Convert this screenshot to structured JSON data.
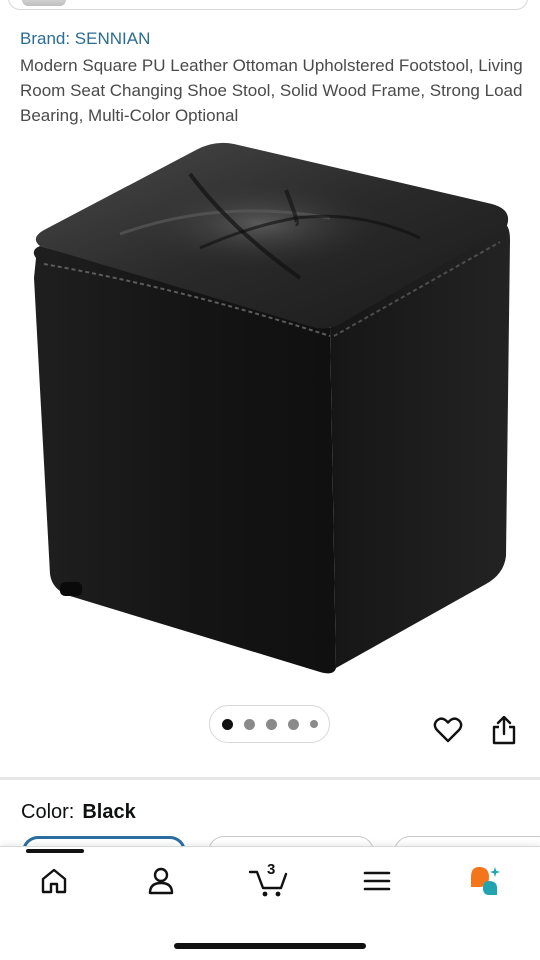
{
  "product": {
    "brand_label": "Brand: SENNIAN",
    "title": "Modern Square PU Leather Ottoman Upholstered Footstool, Living Room Seat Changing Shoe Stool, Solid Wood Frame, Strong Load Bearing, Multi-Color Optional"
  },
  "gallery": {
    "image_count": 5,
    "active_index": 0
  },
  "actions": {
    "favorite_icon": "heart-icon",
    "share_icon": "share-icon"
  },
  "variant": {
    "color_label": "Color:",
    "color_value": "Black"
  },
  "bottom_nav": {
    "items": [
      {
        "icon": "home-icon"
      },
      {
        "icon": "account-icon"
      },
      {
        "icon": "cart-icon",
        "badge": "3"
      },
      {
        "icon": "menu-icon"
      },
      {
        "icon": "ai-assistant-icon"
      }
    ]
  },
  "colors": {
    "link": "#2b6c95",
    "selected_border": "#2a6ea0",
    "ai_orange": "#f5761a",
    "ai_teal": "#1fa4b0"
  }
}
